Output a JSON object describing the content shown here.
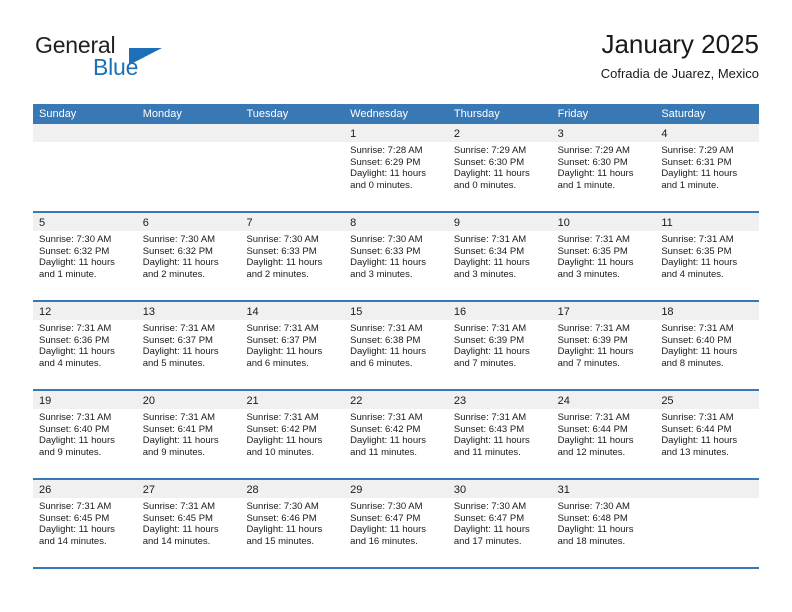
{
  "brand": {
    "word_top": "General",
    "word_bottom": "Blue",
    "triangle_icon": "triangle-icon",
    "color_blue": "#1d70b8",
    "color_dark": "#231f20"
  },
  "header": {
    "title": "January 2025",
    "subtitle": "Cofradia de Juarez, Mexico"
  },
  "theme": {
    "header_row_bg": "#3878b4",
    "header_row_text": "#ffffff",
    "day_band_bg": "#f0f0f0",
    "week_separator": "#3878b4",
    "cell_bg": "#ffffff"
  },
  "weekdays": [
    "Sunday",
    "Monday",
    "Tuesday",
    "Wednesday",
    "Thursday",
    "Friday",
    "Saturday"
  ],
  "weeks": [
    [
      {
        "day": "",
        "lines": ""
      },
      {
        "day": "",
        "lines": ""
      },
      {
        "day": "",
        "lines": ""
      },
      {
        "day": "1",
        "lines": "Sunrise: 7:28 AM\nSunset: 6:29 PM\nDaylight: 11 hours and 0 minutes."
      },
      {
        "day": "2",
        "lines": "Sunrise: 7:29 AM\nSunset: 6:30 PM\nDaylight: 11 hours and 0 minutes."
      },
      {
        "day": "3",
        "lines": "Sunrise: 7:29 AM\nSunset: 6:30 PM\nDaylight: 11 hours and 1 minute."
      },
      {
        "day": "4",
        "lines": "Sunrise: 7:29 AM\nSunset: 6:31 PM\nDaylight: 11 hours and 1 minute."
      }
    ],
    [
      {
        "day": "5",
        "lines": "Sunrise: 7:30 AM\nSunset: 6:32 PM\nDaylight: 11 hours and 1 minute."
      },
      {
        "day": "6",
        "lines": "Sunrise: 7:30 AM\nSunset: 6:32 PM\nDaylight: 11 hours and 2 minutes."
      },
      {
        "day": "7",
        "lines": "Sunrise: 7:30 AM\nSunset: 6:33 PM\nDaylight: 11 hours and 2 minutes."
      },
      {
        "day": "8",
        "lines": "Sunrise: 7:30 AM\nSunset: 6:33 PM\nDaylight: 11 hours and 3 minutes."
      },
      {
        "day": "9",
        "lines": "Sunrise: 7:31 AM\nSunset: 6:34 PM\nDaylight: 11 hours and 3 minutes."
      },
      {
        "day": "10",
        "lines": "Sunrise: 7:31 AM\nSunset: 6:35 PM\nDaylight: 11 hours and 3 minutes."
      },
      {
        "day": "11",
        "lines": "Sunrise: 7:31 AM\nSunset: 6:35 PM\nDaylight: 11 hours and 4 minutes."
      }
    ],
    [
      {
        "day": "12",
        "lines": "Sunrise: 7:31 AM\nSunset: 6:36 PM\nDaylight: 11 hours and 4 minutes."
      },
      {
        "day": "13",
        "lines": "Sunrise: 7:31 AM\nSunset: 6:37 PM\nDaylight: 11 hours and 5 minutes."
      },
      {
        "day": "14",
        "lines": "Sunrise: 7:31 AM\nSunset: 6:37 PM\nDaylight: 11 hours and 6 minutes."
      },
      {
        "day": "15",
        "lines": "Sunrise: 7:31 AM\nSunset: 6:38 PM\nDaylight: 11 hours and 6 minutes."
      },
      {
        "day": "16",
        "lines": "Sunrise: 7:31 AM\nSunset: 6:39 PM\nDaylight: 11 hours and 7 minutes."
      },
      {
        "day": "17",
        "lines": "Sunrise: 7:31 AM\nSunset: 6:39 PM\nDaylight: 11 hours and 7 minutes."
      },
      {
        "day": "18",
        "lines": "Sunrise: 7:31 AM\nSunset: 6:40 PM\nDaylight: 11 hours and 8 minutes."
      }
    ],
    [
      {
        "day": "19",
        "lines": "Sunrise: 7:31 AM\nSunset: 6:40 PM\nDaylight: 11 hours and 9 minutes."
      },
      {
        "day": "20",
        "lines": "Sunrise: 7:31 AM\nSunset: 6:41 PM\nDaylight: 11 hours and 9 minutes."
      },
      {
        "day": "21",
        "lines": "Sunrise: 7:31 AM\nSunset: 6:42 PM\nDaylight: 11 hours and 10 minutes."
      },
      {
        "day": "22",
        "lines": "Sunrise: 7:31 AM\nSunset: 6:42 PM\nDaylight: 11 hours and 11 minutes."
      },
      {
        "day": "23",
        "lines": "Sunrise: 7:31 AM\nSunset: 6:43 PM\nDaylight: 11 hours and 11 minutes."
      },
      {
        "day": "24",
        "lines": "Sunrise: 7:31 AM\nSunset: 6:44 PM\nDaylight: 11 hours and 12 minutes."
      },
      {
        "day": "25",
        "lines": "Sunrise: 7:31 AM\nSunset: 6:44 PM\nDaylight: 11 hours and 13 minutes."
      }
    ],
    [
      {
        "day": "26",
        "lines": "Sunrise: 7:31 AM\nSunset: 6:45 PM\nDaylight: 11 hours and 14 minutes."
      },
      {
        "day": "27",
        "lines": "Sunrise: 7:31 AM\nSunset: 6:45 PM\nDaylight: 11 hours and 14 minutes."
      },
      {
        "day": "28",
        "lines": "Sunrise: 7:30 AM\nSunset: 6:46 PM\nDaylight: 11 hours and 15 minutes."
      },
      {
        "day": "29",
        "lines": "Sunrise: 7:30 AM\nSunset: 6:47 PM\nDaylight: 11 hours and 16 minutes."
      },
      {
        "day": "30",
        "lines": "Sunrise: 7:30 AM\nSunset: 6:47 PM\nDaylight: 11 hours and 17 minutes."
      },
      {
        "day": "31",
        "lines": "Sunrise: 7:30 AM\nSunset: 6:48 PM\nDaylight: 11 hours and 18 minutes."
      },
      {
        "day": "",
        "lines": ""
      }
    ]
  ]
}
